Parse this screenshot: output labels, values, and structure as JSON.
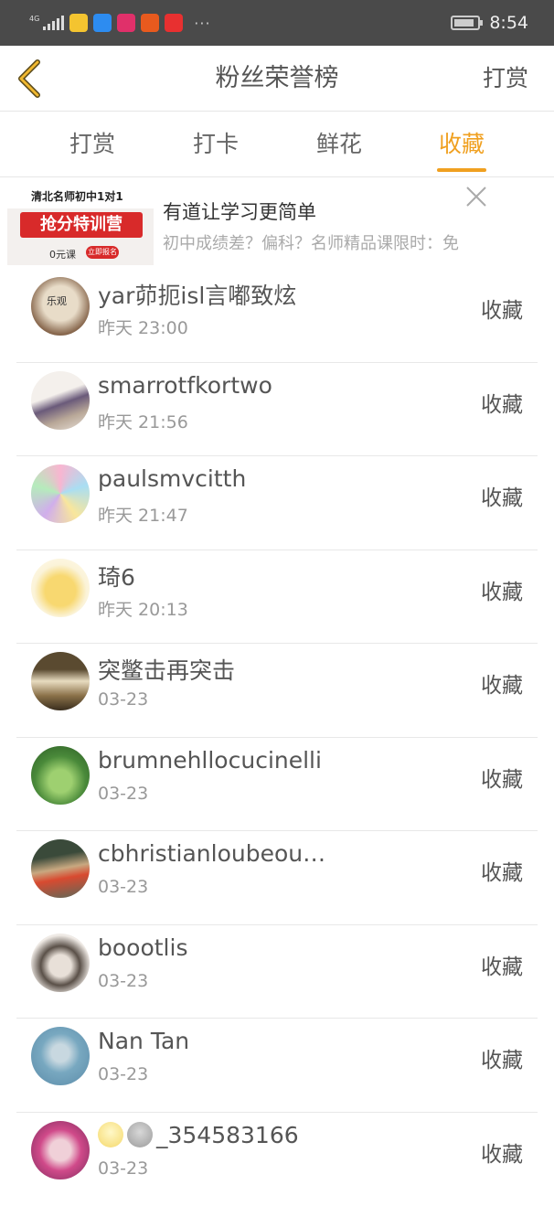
{
  "status_bar": {
    "network": "4G",
    "time": "8:54",
    "more": "···",
    "battery_level": 0.85
  },
  "nav": {
    "back_icon": "chevron-left-icon",
    "title": "粉丝荣誉榜",
    "action": "打赏"
  },
  "tabs": [
    {
      "label": "打赏",
      "active": false
    },
    {
      "label": "打卡",
      "active": false
    },
    {
      "label": "鲜花",
      "active": false
    },
    {
      "label": "收藏",
      "active": true
    }
  ],
  "ad": {
    "image": {
      "header": "清北名师初中1对1",
      "banner": "抢分特训营",
      "price": "0元课",
      "button": "立即报名"
    },
    "title": "有道让学习更简单",
    "description": "初中成绩差？偏科？名师精品课限时：免",
    "close_icon": "close-icon"
  },
  "list": [
    {
      "name": "yar茆扼isl言嘟致炫",
      "time": "昨天 23:00",
      "action": "收藏"
    },
    {
      "name": "smarrotfkortwo",
      "time": "昨天 21:56",
      "action": "收藏"
    },
    {
      "name": "paulsmvcitth",
      "time": "昨天 21:47",
      "action": "收藏"
    },
    {
      "name": "琦6",
      "time": "昨天 20:13",
      "action": "收藏"
    },
    {
      "name": "突鳖击再突击",
      "time": "03-23",
      "action": "收藏"
    },
    {
      "name": "brumnehllocucinelli",
      "time": "03-23",
      "action": "收藏"
    },
    {
      "name": "cbhristianloubeou…",
      "time": "03-23",
      "action": "收藏"
    },
    {
      "name": "boootlis",
      "time": "03-23",
      "action": "收藏"
    },
    {
      "name": "Nan Tan",
      "time": "03-23",
      "action": "收藏"
    },
    {
      "name": "_354583166",
      "time": "03-23",
      "action": "收藏"
    }
  ],
  "colors": {
    "accent": "#f0a020",
    "status_bar": "#4a4a4a"
  }
}
